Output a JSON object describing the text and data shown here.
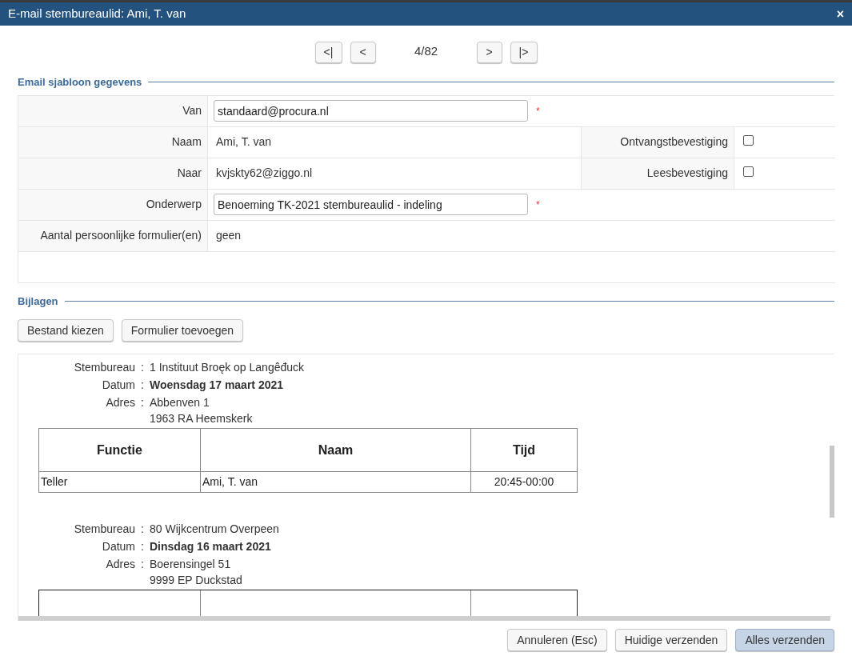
{
  "dialog": {
    "title": "E-mail stembureaulid: Ami, T. van",
    "close": "×"
  },
  "pager": {
    "first": "<|",
    "previous": "<",
    "position": "4/82",
    "next": ">",
    "last": "|>"
  },
  "template_section": {
    "title": "Email sjabloon gegevens",
    "fields": [
      {
        "kind": "input",
        "label": "Van",
        "value": "standaard@procura.nl",
        "required_mark": "*"
      },
      {
        "kind": "text",
        "label": "Naam",
        "value": "Ami, T. van",
        "option": {
          "label": "Ontvangstbevestiging",
          "checked": false
        }
      },
      {
        "kind": "text",
        "label": "Naar",
        "value": "kvjskty62@ziggo.nl",
        "option": {
          "label": "Leesbevestiging",
          "checked": false
        }
      },
      {
        "kind": "input",
        "label": "Onderwerp",
        "value": "Benoeming TK-2021 stembureaulid - indeling",
        "required_mark": "*"
      },
      {
        "kind": "text",
        "label": "Aantal persoonlijke formulier(en)",
        "value": "geen"
      }
    ]
  },
  "attachments_section": {
    "title": "Bijlagen",
    "buttons": [
      "Bestand kiezen",
      "Formulier toevoegen"
    ],
    "documents": [
      {
        "info": [
          {
            "label": "Stembureau",
            "separator": ":",
            "lines": [
              "1 Instituut Broęk op Langêđuck"
            ],
            "bold": false
          },
          {
            "label": "Datum",
            "separator": ":",
            "lines": [
              "Woensdag 17 maart 2021"
            ],
            "bold": true
          },
          {
            "label": "Adres",
            "separator": ":",
            "lines": [
              "Abbenven 1",
              "1963 RA Heemskerk"
            ],
            "bold": false
          }
        ],
        "table": {
          "columns": [
            "Functie",
            "Naam",
            "Tijd"
          ],
          "rows": [
            [
              "Teller",
              "Ami, T. van",
              "20:45-00:00"
            ]
          ]
        }
      },
      {
        "info": [
          {
            "label": "Stembureau",
            "separator": ":",
            "lines": [
              "80 Wijkcentrum Overpeen"
            ],
            "bold": false
          },
          {
            "label": "Datum",
            "separator": ":",
            "lines": [
              "Dinsdag 16 maart 2021"
            ],
            "bold": true
          },
          {
            "label": "Adres",
            "separator": ":",
            "lines": [
              "Boerensingel 51",
              "9999 EP Duckstad"
            ],
            "bold": false
          }
        ],
        "table_header_cut": true
      }
    ]
  },
  "footer": {
    "buttons": [
      {
        "label": "Annuleren (Esc)",
        "primary": false
      },
      {
        "label": "Huidige verzenden",
        "primary": false
      },
      {
        "label": "Alles verzenden",
        "primary": true
      }
    ]
  }
}
